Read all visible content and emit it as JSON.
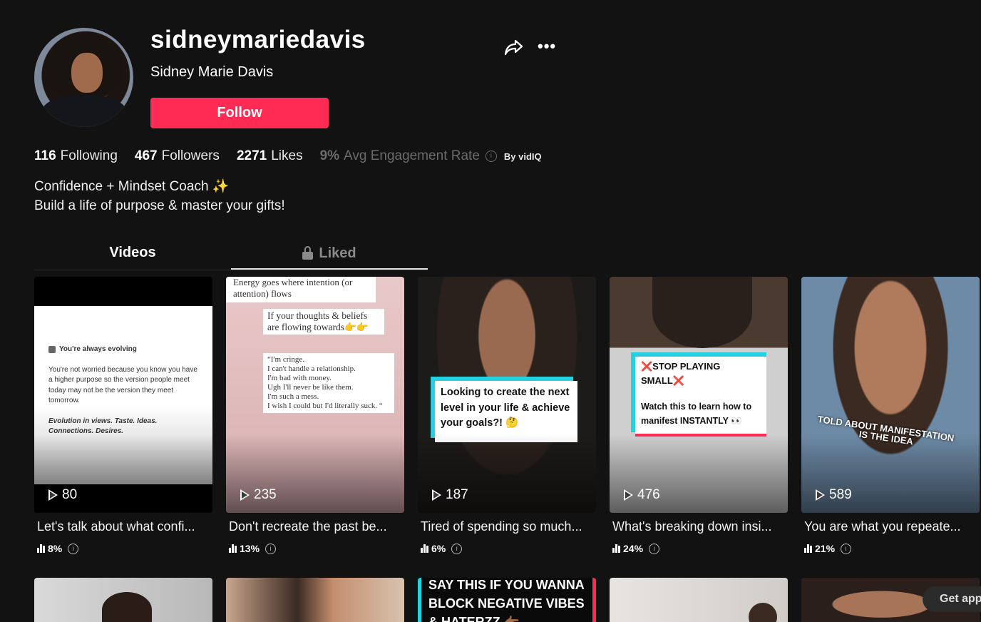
{
  "profile": {
    "username": "sidneymariedavis",
    "display_name": "Sidney Marie Davis",
    "follow_label": "Follow",
    "stats": {
      "following_count": "116",
      "following_label": "Following",
      "followers_count": "467",
      "followers_label": "Followers",
      "likes_count": "2271",
      "likes_label": "Likes",
      "engagement_value": "9%",
      "engagement_label": "Avg Engagement Rate",
      "by_label": "By vidIQ"
    },
    "bio_line1": "Confidence + Mindset Coach ✨",
    "bio_line2": "Build a life of purpose & master your gifts!"
  },
  "tabs": {
    "videos": "Videos",
    "liked": "Liked"
  },
  "videos": [
    {
      "views": "80",
      "caption": "Let's talk about what confi...",
      "engagement": "8%",
      "overlay": {
        "check_label": "You're always evolving",
        "body": "You're not worried because you know you have a higher purpose so the version people meet today may not be the version they meet tomorrow.",
        "italic": "Evolution in views. Taste. Ideas. Connections. Desires."
      }
    },
    {
      "views": "235",
      "caption": "Don't recreate the past be...",
      "engagement": "13%",
      "overlay": {
        "top": "Energy goes where intention (or attention) flows",
        "mid": "If your thoughts & beliefs are flowing towards👉👉",
        "quote_lines": [
          "“I'm cringe.",
          "I can't handle a relationship.",
          "I'm bad with money.",
          "Ugh I'll never be like them.",
          "I'm such a mess.",
          "I wish I could but I'd literally suck. “"
        ]
      }
    },
    {
      "views": "187",
      "caption": "Tired of spending so much...",
      "engagement": "6%",
      "overlay": {
        "text": "Looking to create the next level in your life & achieve your goals?! 🤔"
      }
    },
    {
      "views": "476",
      "caption": "What's breaking down insi...",
      "engagement": "24%",
      "overlay": {
        "title": "❌STOP PLAYING SMALL❌",
        "body": "Watch this to learn how to manifest INSTANTLY 👀"
      }
    },
    {
      "views": "589",
      "caption": "You are what you repeate...",
      "engagement": "21%",
      "overlay": {
        "text_line1": "TOLD ABOUT MANIFESTATION",
        "text_line2": "IS THE IDEA"
      }
    }
  ],
  "row2_overlay": {
    "line1": "SAY THIS IF YOU WANNA",
    "line2": "BLOCK NEGATIVE VIBES",
    "line3": "& HATERZZ 👉🏾"
  },
  "get_app_label": "Get app",
  "colors": {
    "accent": "#fe2c55",
    "background": "#121212"
  },
  "icons": [
    "share-icon",
    "more-icon",
    "lock-icon",
    "play-icon",
    "engagement-bars-icon",
    "info-icon"
  ]
}
